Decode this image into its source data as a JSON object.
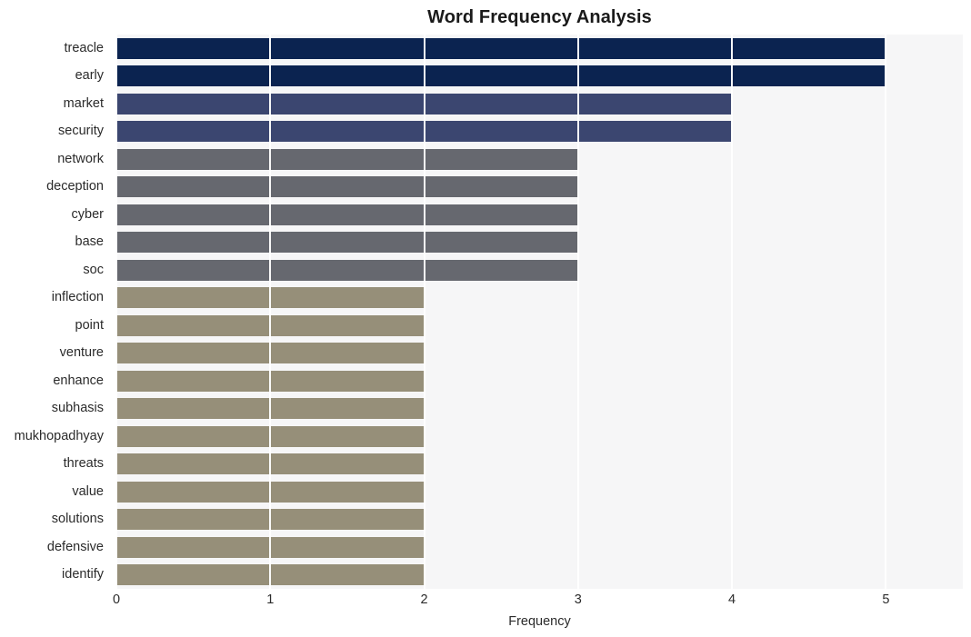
{
  "chart_data": {
    "type": "bar",
    "orientation": "horizontal",
    "title": "Word Frequency Analysis",
    "xlabel": "Frequency",
    "ylabel": "",
    "xlim": [
      0,
      5.5
    ],
    "xticks": [
      "0",
      "1",
      "2",
      "3",
      "4",
      "5"
    ],
    "xtick_values": [
      0,
      1,
      2,
      3,
      4,
      5
    ],
    "grid": "vertical-white",
    "legend": "none",
    "categories": [
      "treacle",
      "early",
      "market",
      "security",
      "network",
      "deception",
      "cyber",
      "base",
      "soc",
      "inflection",
      "point",
      "venture",
      "enhance",
      "subhasis",
      "mukhopadhyay",
      "threats",
      "value",
      "solutions",
      "defensive",
      "identify"
    ],
    "values": [
      5,
      5,
      4,
      4,
      3,
      3,
      3,
      3,
      3,
      2,
      2,
      2,
      2,
      2,
      2,
      2,
      2,
      2,
      2,
      2
    ],
    "bar_colors": [
      "#0b2350",
      "#0b2350",
      "#3b4670",
      "#3b4670",
      "#66686f",
      "#66686f",
      "#66686f",
      "#66686f",
      "#66686f",
      "#968f79",
      "#968f79",
      "#968f79",
      "#968f79",
      "#968f79",
      "#968f79",
      "#968f79",
      "#968f79",
      "#968f79",
      "#968f79",
      "#968f79"
    ]
  },
  "theme": {
    "plot_background": "#f6f6f7",
    "figure_background": "#ffffff",
    "gridline_color": "#ffffff",
    "text_color": "#2b2b2b",
    "title_color": "#1a1a1a"
  }
}
